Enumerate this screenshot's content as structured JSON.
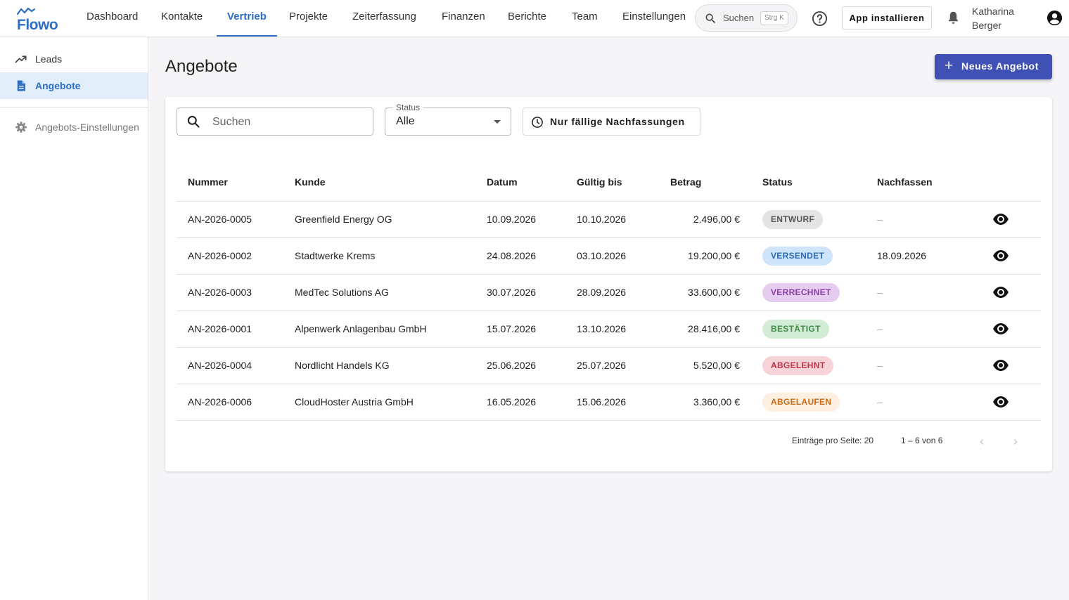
{
  "app": {
    "name": "Flowo",
    "brand_color": "#2d6fc6",
    "accent_color": "#3f51b5"
  },
  "nav": {
    "tabs": [
      {
        "label": "Dashboard",
        "active": false
      },
      {
        "label": "Kontakte",
        "active": false
      },
      {
        "label": "Vertrieb",
        "active": true
      },
      {
        "label": "Projekte",
        "active": false
      },
      {
        "label": "Zeiterfassung",
        "active": false
      },
      {
        "label": "Finanzen",
        "active": false
      },
      {
        "label": "Berichte",
        "active": false
      },
      {
        "label": "Team",
        "active": false
      },
      {
        "label": "Einstellungen",
        "active": false
      }
    ],
    "search_label": "Suchen",
    "search_shortcut": "Strg K",
    "install_label": "App installieren",
    "user_first": "Katharina",
    "user_last": "Berger"
  },
  "sidebar": {
    "items": [
      {
        "label": "Leads",
        "icon": "trending-up-icon",
        "active": false
      },
      {
        "label": "Angebote",
        "icon": "document-icon",
        "active": true
      }
    ],
    "settings_label": "Angebots-Einstellungen"
  },
  "page": {
    "title": "Angebote",
    "new_button": "Neues Angebot",
    "search_placeholder": "Suchen",
    "status_legend": "Status",
    "status_value": "Alle",
    "due_button": "Nur fällige Nachfassungen"
  },
  "table": {
    "columns": [
      "Nummer",
      "Kunde",
      "Datum",
      "Gültig bis",
      "Betrag",
      "Status",
      "Nachfassen"
    ],
    "rows": [
      {
        "nummer": "AN-2026-0005",
        "kunde": "Greenfield Energy OG",
        "datum": "10.09.2026",
        "gueltig": "10.10.2026",
        "betrag": "2.496,00 €",
        "status": "ENTWURF",
        "status_bg": "#e4e4e6",
        "status_fg": "#555555",
        "nachfassen": "–"
      },
      {
        "nummer": "AN-2026-0002",
        "kunde": "Stadtwerke Krems",
        "datum": "24.08.2026",
        "gueltig": "03.10.2026",
        "betrag": "19.200,00 €",
        "status": "VERSENDET",
        "status_bg": "#cde4fb",
        "status_fg": "#2a6bb8",
        "nachfassen": "18.09.2026"
      },
      {
        "nummer": "AN-2026-0003",
        "kunde": "MedTec Solutions AG",
        "datum": "30.07.2026",
        "gueltig": "28.09.2026",
        "betrag": "33.600,00 €",
        "status": "VERRECHNET",
        "status_bg": "#e6cdf0",
        "status_fg": "#8a3ea6",
        "nachfassen": "–"
      },
      {
        "nummer": "AN-2026-0001",
        "kunde": "Alpenwerk Anlagenbau GmbH",
        "datum": "15.07.2026",
        "gueltig": "13.10.2026",
        "betrag": "28.416,00 €",
        "status": "BESTÄTIGT",
        "status_bg": "#d3ecd6",
        "status_fg": "#3f8a47",
        "nachfassen": "–"
      },
      {
        "nummer": "AN-2026-0004",
        "kunde": "Nordlicht Handels KG",
        "datum": "25.06.2026",
        "gueltig": "25.07.2026",
        "betrag": "5.520,00 €",
        "status": "ABGELEHNT",
        "status_bg": "#f6d3d8",
        "status_fg": "#c2344a",
        "nachfassen": "–"
      },
      {
        "nummer": "AN-2026-0006",
        "kunde": "CloudHoster Austria GmbH",
        "datum": "16.05.2026",
        "gueltig": "15.06.2026",
        "betrag": "3.360,00 €",
        "status": "ABGELAUFEN",
        "status_bg": "#fdf0e1",
        "status_fg": "#c96a16",
        "nachfassen": "–"
      }
    ]
  },
  "pagination": {
    "per_page_label": "Einträge pro Seite: 20",
    "range": "1 – 6 von 6",
    "prev_icon": "chevron-left-icon",
    "next_icon": "chevron-right-icon"
  }
}
